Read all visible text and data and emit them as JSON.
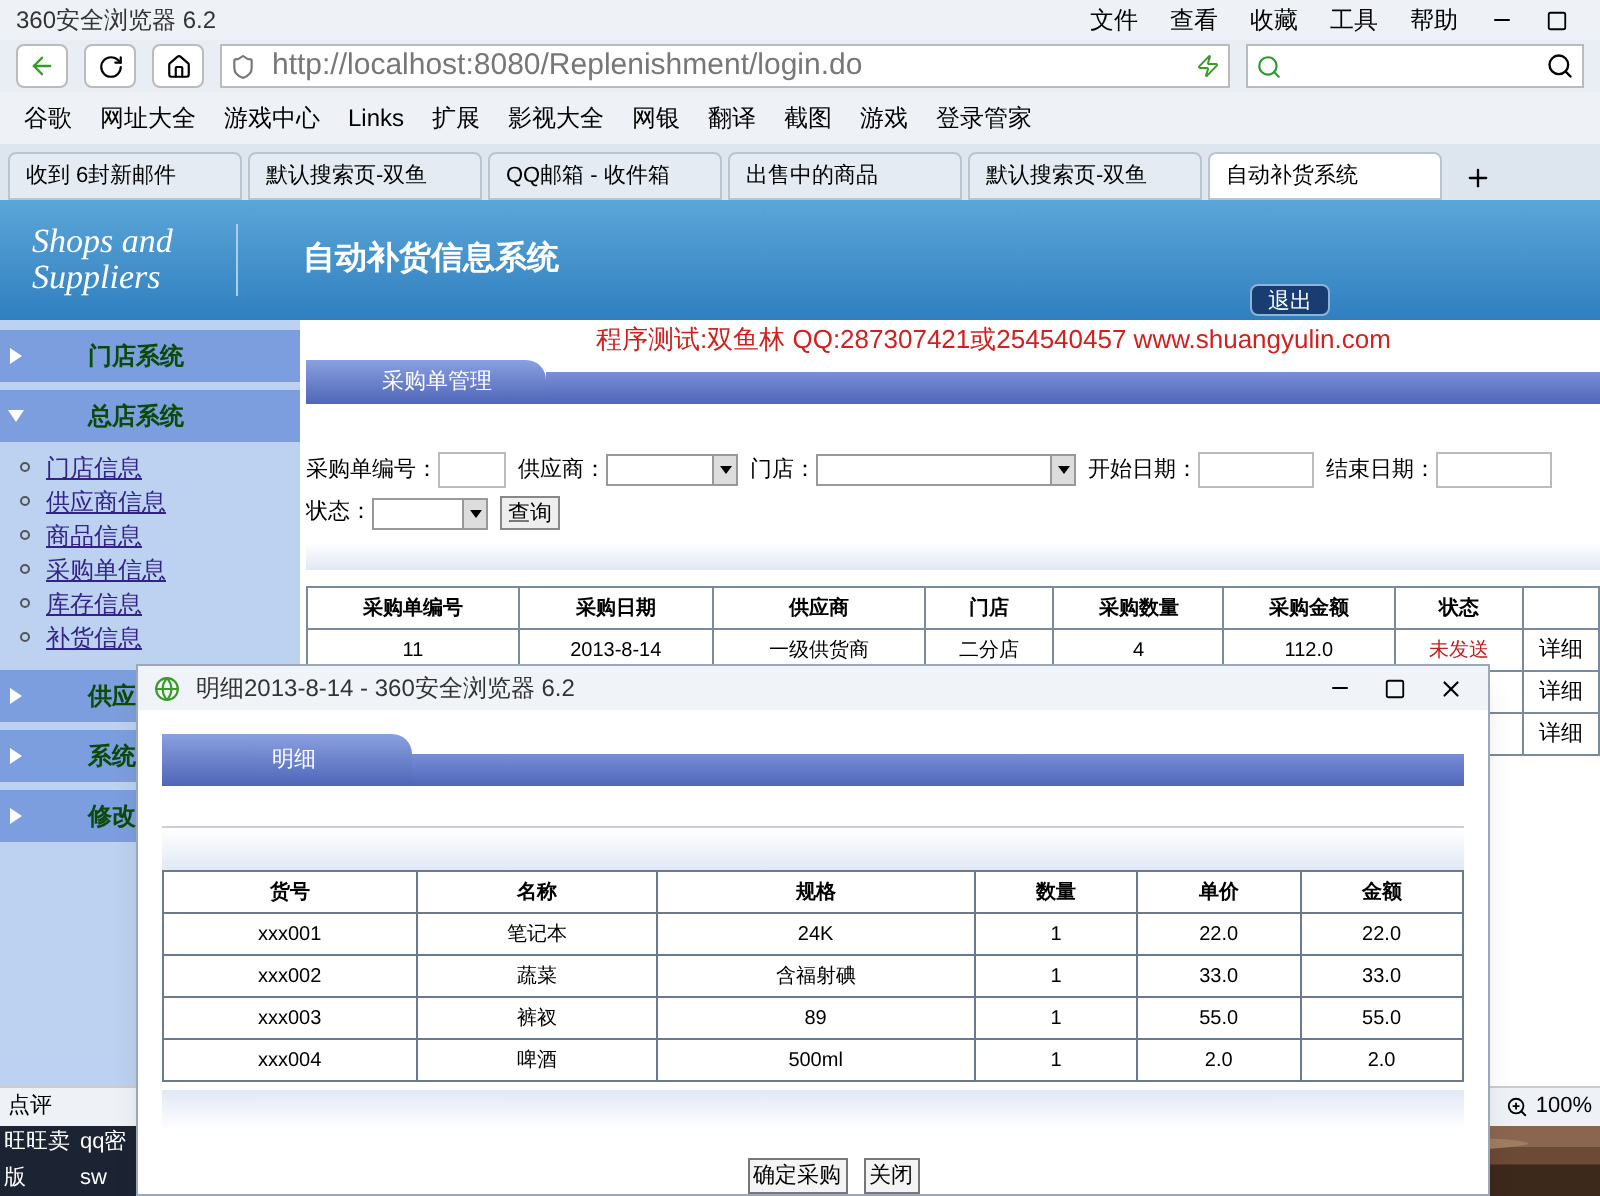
{
  "browser": {
    "title": "360安全浏览器 6.2",
    "menu": [
      "文件",
      "查看",
      "收藏",
      "工具",
      "帮助"
    ],
    "url": "http://localhost:8080/Replenishment/login.do",
    "bookmarks": [
      "谷歌",
      "网址大全",
      "游戏中心",
      "Links",
      "扩展",
      "影视大全",
      "网银",
      "翻译",
      "截图",
      "游戏",
      "登录管家"
    ],
    "tabs": [
      {
        "label": "收到 6封新邮件",
        "selected": false
      },
      {
        "label": "默认搜索页-双鱼",
        "selected": false
      },
      {
        "label": "QQ邮箱 - 收件箱",
        "selected": false
      },
      {
        "label": "出售中的商品",
        "selected": false
      },
      {
        "label": "默认搜索页-双鱼",
        "selected": false
      },
      {
        "label": "自动补货系统",
        "selected": true
      }
    ]
  },
  "header": {
    "logo_lines": [
      "Shops and",
      "Suppliers"
    ],
    "title": "自动补货信息系统",
    "logout": "退出"
  },
  "notice": "程序测试:双鱼林 QQ:287307421或254540457 www.shuangyulin.com",
  "sidebar": [
    {
      "label": "门店系统",
      "expanded": false
    },
    {
      "label": "总店系统",
      "expanded": true,
      "children": [
        {
          "label": "门店信息"
        },
        {
          "label": "供应商信息"
        },
        {
          "label": "商品信息"
        },
        {
          "label": "采购单信息"
        },
        {
          "label": "库存信息"
        },
        {
          "label": "补货信息"
        }
      ]
    },
    {
      "label": "供应",
      "expanded": false
    },
    {
      "label": "系统",
      "expanded": false
    },
    {
      "label": "修改",
      "expanded": false
    }
  ],
  "panel": {
    "tab": "采购单管理",
    "filters": [
      {
        "kind": "text",
        "label": "采购单编号："
      },
      {
        "kind": "select",
        "label": "供应商："
      },
      {
        "kind": "select",
        "label": "门店："
      },
      {
        "kind": "text",
        "label": "开始日期："
      },
      {
        "kind": "text",
        "label": "结束日期："
      },
      {
        "kind": "select",
        "label": "状态："
      }
    ],
    "query_button": "查询"
  },
  "table": {
    "columns": [
      "采购单编号",
      "采购日期",
      "供应商",
      "门店",
      "采购数量",
      "采购金额",
      "状态"
    ],
    "rows": [
      {
        "cells": [
          "11",
          "2013-8-14",
          "一级供货商",
          "二分店",
          "4",
          "112.0",
          "未发送"
        ],
        "action": "详细"
      },
      {
        "action": "详细"
      },
      {
        "action": "详细"
      }
    ]
  },
  "popup": {
    "title": "明细2013-8-14 - 360安全浏览器 6.2",
    "tab": "明细",
    "columns": [
      "货号",
      "名称",
      "规格",
      "数量",
      "单价",
      "金额"
    ],
    "rows": [
      [
        "xxx001",
        "笔记本",
        "24K",
        "1",
        "22.0",
        "22.0"
      ],
      [
        "xxx002",
        "蔬菜",
        "含福射碘",
        "1",
        "33.0",
        "33.0"
      ],
      [
        "xxx003",
        "裤衩",
        "89",
        "1",
        "55.0",
        "55.0"
      ],
      [
        "xxx004",
        "啤酒",
        "500ml",
        "1",
        "2.0",
        "2.0"
      ]
    ],
    "buttons": [
      "确定采购",
      "关闭"
    ]
  },
  "status_bar": {
    "left": "点评",
    "zoom": "100%"
  },
  "taskbar": [
    "旺旺卖",
    "qq密",
    "版",
    "sw"
  ]
}
